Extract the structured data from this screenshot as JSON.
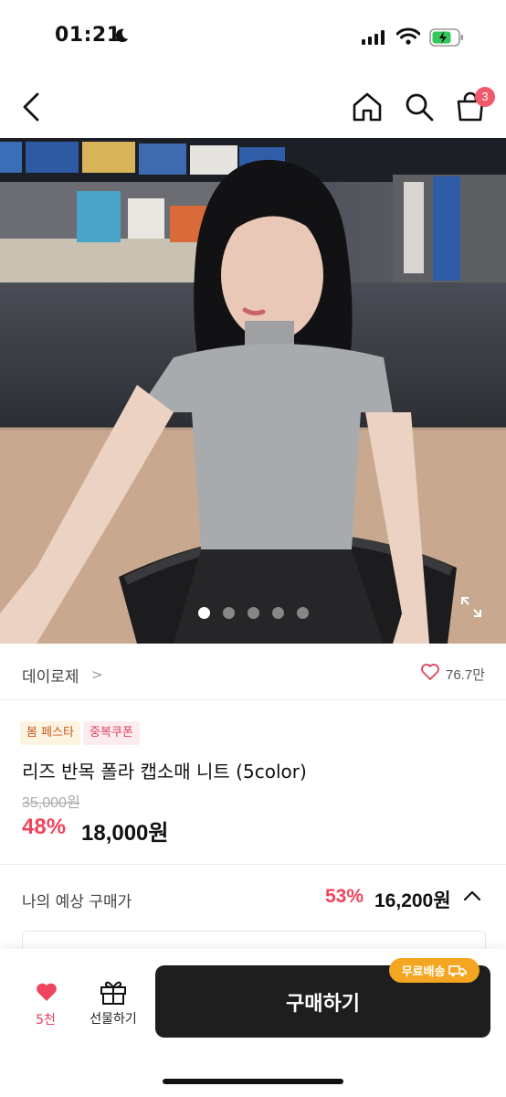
{
  "status_bar": {
    "time": "01:21",
    "battery_charging": true
  },
  "nav": {
    "cart_count": "3"
  },
  "gallery": {
    "total_images": 5,
    "active_index": 0
  },
  "brand": {
    "name": "데이로제",
    "chevron": ">",
    "likes": "76.7만"
  },
  "tags": [
    "봄 페스타",
    "중복쿠폰"
  ],
  "product": {
    "name": "리즈 반목 폴라 캡소매 니트 (5color)",
    "original_price": "35,000원",
    "discount": "48%",
    "price": "18,000원"
  },
  "expected": {
    "label": "나의 예상 구매가",
    "discount": "53%",
    "price": "16,200원"
  },
  "bottom": {
    "wish_count": "5천",
    "gift_label": "선물하기",
    "buy_label": "구매하기",
    "free_shipping": "무료배송"
  },
  "colors": {
    "accent": "#f0445c",
    "badge": "#f05a6a",
    "button": "#1e1e1e",
    "shipping": "#f4a623"
  }
}
